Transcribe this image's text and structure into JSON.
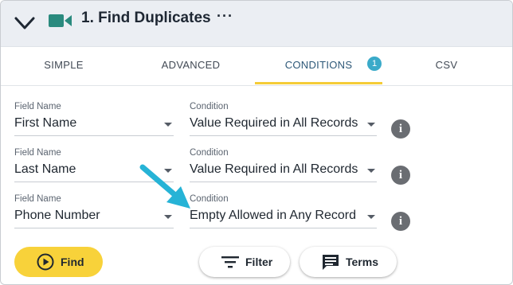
{
  "header": {
    "title": "1. Find Duplicates",
    "more_label": "···",
    "icon": "video-camera-icon",
    "icon_color": "#2a8a7e"
  },
  "tabs": [
    {
      "label": "Simple",
      "active": false
    },
    {
      "label": "Advanced",
      "active": false
    },
    {
      "label": "Conditions",
      "active": true,
      "badge": "1"
    },
    {
      "label": "CSV",
      "active": false
    }
  ],
  "rows": [
    {
      "field_label": "Field Name",
      "field_value": "First Name",
      "condition_label": "Condition",
      "condition_value": "Value Required in All Records"
    },
    {
      "field_label": "Field Name",
      "field_value": "Last Name",
      "condition_label": "Condition",
      "condition_value": "Value Required in All Records"
    },
    {
      "field_label": "Field Name",
      "field_value": "Phone Number",
      "condition_label": "Condition",
      "condition_value": "Empty Allowed in Any Record"
    }
  ],
  "info_glyph": "i",
  "buttons": {
    "find": "Find",
    "filter": "Filter",
    "terms": "Terms"
  },
  "colors": {
    "accent_yellow": "#f8d23a",
    "badge_blue": "#3aaac9",
    "arrow_cyan": "#26b3d6"
  }
}
